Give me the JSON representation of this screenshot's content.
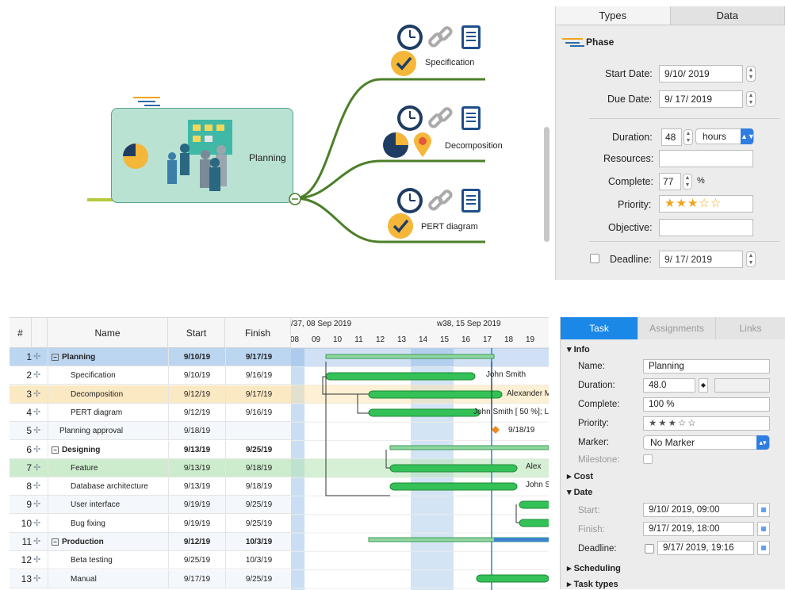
{
  "mindmap": {
    "central_label": "Planning",
    "children": [
      {
        "label": "Specification"
      },
      {
        "label": "Decomposition"
      },
      {
        "label": "PERT diagram"
      }
    ]
  },
  "props_panel": {
    "tabs": [
      "Types",
      "Data"
    ],
    "active_tab": "Data",
    "title": "Phase",
    "start_date_label": "Start Date:",
    "start_date": "9/10/ 2019",
    "due_date_label": "Due Date:",
    "due_date": "9/ 17/ 2019",
    "duration_label": "Duration:",
    "duration": "48",
    "duration_unit": "hours",
    "resources_label": "Resources:",
    "resources": "",
    "complete_label": "Complete:",
    "complete": "77",
    "complete_unit": "%",
    "priority_label": "Priority:",
    "priority_stars": "★★★☆☆",
    "objective_label": "Objective:",
    "objective": "",
    "deadline_label": "Deadline:",
    "deadline": "9/ 17/ 2019"
  },
  "gantt": {
    "headers": {
      "num": "#",
      "name": "Name",
      "start": "Start",
      "finish": "Finish"
    },
    "week_labels": [
      "/37, 08 Sep 2019",
      "w38, 15 Sep 2019"
    ],
    "days": [
      "08",
      "09",
      "10",
      "11",
      "12",
      "13",
      "14",
      "15",
      "16",
      "17",
      "18",
      "19",
      "2"
    ],
    "rows": [
      {
        "num": "1",
        "name": "Planning",
        "start": "9/10/19",
        "finish": "9/17/19",
        "summary": true
      },
      {
        "num": "2",
        "name": "Specification",
        "start": "9/10/19",
        "finish": "9/16/19"
      },
      {
        "num": "3",
        "name": "Decomposition",
        "start": "9/12/19",
        "finish": "9/17/19"
      },
      {
        "num": "4",
        "name": "PERT diagram",
        "start": "9/12/19",
        "finish": "9/16/19"
      },
      {
        "num": "5",
        "name": "Planning approval",
        "start": "9/18/19",
        "finish": ""
      },
      {
        "num": "6",
        "name": "Designing",
        "start": "9/13/19",
        "finish": "9/25/19",
        "summary": true
      },
      {
        "num": "7",
        "name": "Feature",
        "start": "9/13/19",
        "finish": "9/18/19"
      },
      {
        "num": "8",
        "name": "Database architecture",
        "start": "9/13/19",
        "finish": "9/18/19"
      },
      {
        "num": "9",
        "name": "User interface",
        "start": "9/19/19",
        "finish": "9/25/19"
      },
      {
        "num": "10",
        "name": "Bug fixing",
        "start": "9/19/19",
        "finish": "9/25/19"
      },
      {
        "num": "11",
        "name": "Production",
        "start": "9/12/19",
        "finish": "10/3/19",
        "summary": true
      },
      {
        "num": "12",
        "name": "Beta testing",
        "start": "9/25/19",
        "finish": "10/3/19"
      },
      {
        "num": "13",
        "name": "Manual",
        "start": "9/17/19",
        "finish": "9/25/19"
      }
    ],
    "bar_labels": {
      "spec": "John Smith",
      "decomp": "Alexander Mi",
      "pert": "John Smith [ 50 %]; Li",
      "milestone": "9/18/19",
      "feature": "Alex",
      "db": "John S"
    }
  },
  "task_panel": {
    "tabs": [
      "Task",
      "Assignments",
      "Links"
    ],
    "active_tab": "Task",
    "info_section": "Info",
    "name_label": "Name:",
    "name": "Planning",
    "duration_label": "Duration:",
    "duration": "48.0",
    "complete_label": "Complete:",
    "complete": "100 %",
    "priority_label": "Priority:",
    "priority_stars": "★★★☆☆",
    "marker_label": "Marker:",
    "marker": "No Marker",
    "milestone_label": "Milestone:",
    "cost_section": "Cost",
    "date_section": "Date",
    "start_label": "Start:",
    "start": "9/10/ 2019, 09:00",
    "finish_label": "Finish:",
    "finish": "9/17/ 2019, 18:00",
    "deadline_label": "Deadline:",
    "deadline": "9/17/ 2019, 19:16",
    "scheduling_section": "Scheduling",
    "task_types_section": "Task types"
  }
}
